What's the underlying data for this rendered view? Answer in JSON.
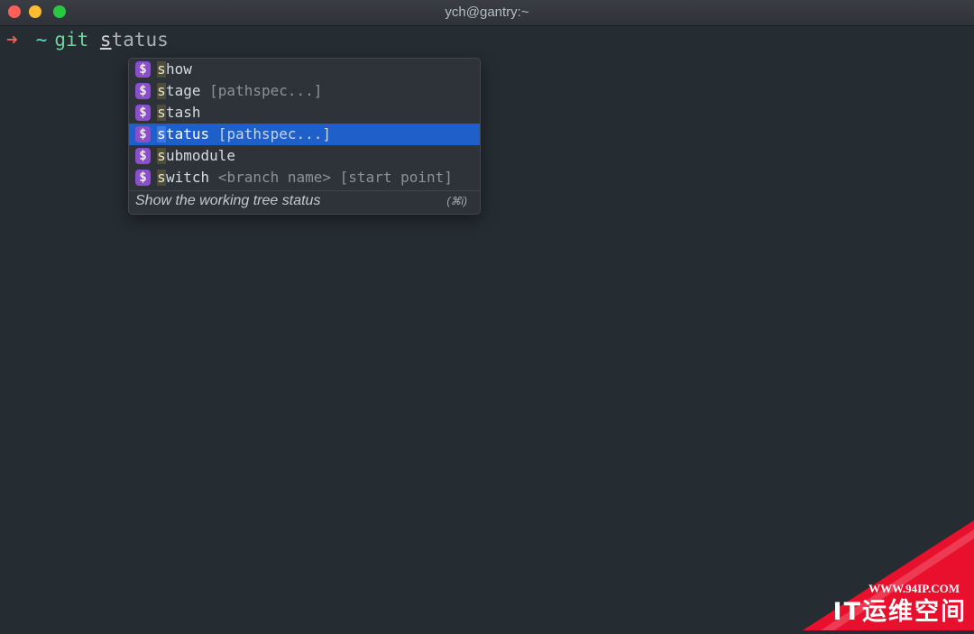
{
  "window": {
    "title": "ych@gantry:~"
  },
  "prompt": {
    "arrow": "➜",
    "cwd": "~",
    "command": "git",
    "typed_first": "s",
    "typed_rest": "tatus"
  },
  "completions": {
    "items": [
      {
        "badge": "$",
        "first": "s",
        "rest": "how",
        "args": ""
      },
      {
        "badge": "$",
        "first": "s",
        "rest": "tage",
        "args": " [pathspec...]"
      },
      {
        "badge": "$",
        "first": "s",
        "rest": "tash",
        "args": ""
      },
      {
        "badge": "$",
        "first": "s",
        "rest": "tatus",
        "args": " [pathspec...]",
        "selected": true
      },
      {
        "badge": "$",
        "first": "s",
        "rest": "ubmodule",
        "args": ""
      },
      {
        "badge": "$",
        "first": "s",
        "rest": "witch",
        "args": " <branch name> [start point]"
      }
    ],
    "description": "Show the working tree status",
    "shortcut": "(⌘i)"
  },
  "watermark": {
    "url": "WWW.94IP.COM",
    "brand": "IT运维空间"
  },
  "colors": {
    "background": "#252d33",
    "selection": "#1f5fc9",
    "badge": "#8a4fcb",
    "watermark": "#e8102d"
  }
}
